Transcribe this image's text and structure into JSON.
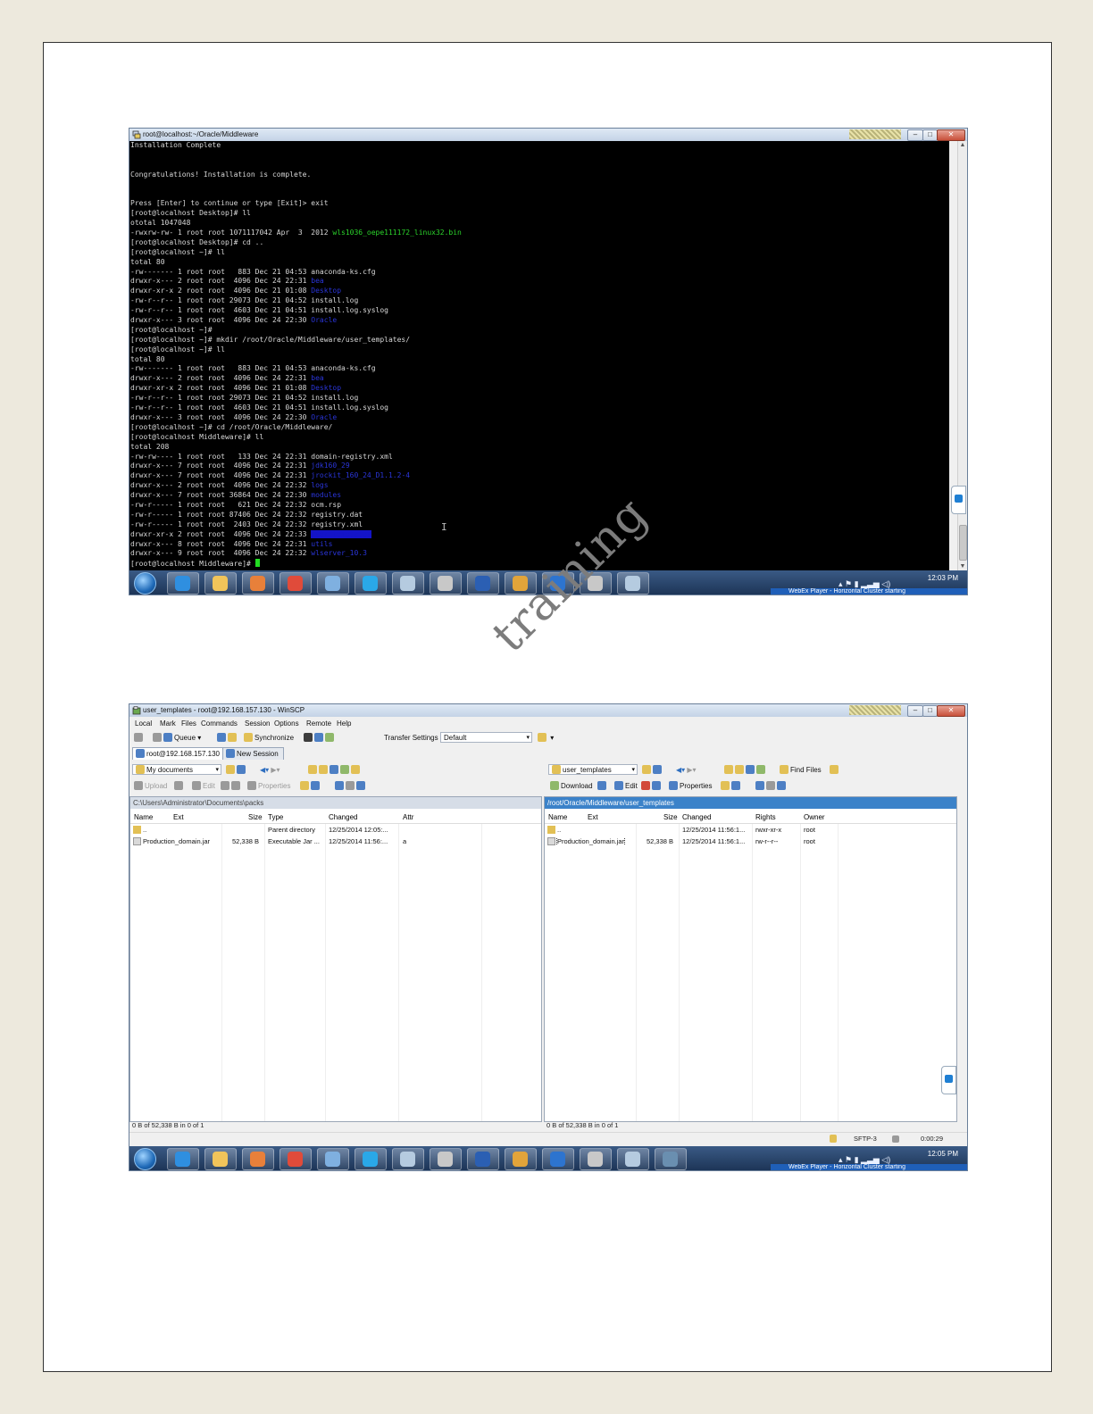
{
  "terminal_window": {
    "title": "root@localhost:~/Oracle/Middleware",
    "lines": [
      [
        {
          "t": "Installation Complete"
        }
      ],
      [
        {
          "t": ""
        }
      ],
      [
        {
          "t": ""
        }
      ],
      [
        {
          "t": "Congratulations! Installation is complete."
        }
      ],
      [
        {
          "t": ""
        }
      ],
      [
        {
          "t": ""
        }
      ],
      [
        {
          "t": "Press [Enter] to continue or type [Exit]> exit"
        }
      ],
      [
        {
          "t": "[root@localhost Desktop]# ll"
        }
      ],
      [
        {
          "t": "ototal 1047048"
        }
      ],
      [
        {
          "t": "-rwxrw-rw- 1 root root 1071117042 Apr  3  2012 "
        },
        {
          "t": "wls1036_oepe111172_linux32.bin",
          "c": "green"
        }
      ],
      [
        {
          "t": "[root@localhost Desktop]# cd .."
        }
      ],
      [
        {
          "t": "[root@localhost ~]# ll"
        }
      ],
      [
        {
          "t": "total 80"
        }
      ],
      [
        {
          "t": "-rw------- 1 root root   883 Dec 21 04:53 anaconda-ks.cfg"
        }
      ],
      [
        {
          "t": "drwxr-x--- 2 root root  4096 Dec 24 22:31 "
        },
        {
          "t": "bea",
          "c": "blue"
        }
      ],
      [
        {
          "t": "drwxr-xr-x 2 root root  4096 Dec 21 01:08 "
        },
        {
          "t": "Desktop",
          "c": "blue"
        }
      ],
      [
        {
          "t": "-rw-r--r-- 1 root root 29073 Dec 21 04:52 install.log"
        }
      ],
      [
        {
          "t": "-rw-r--r-- 1 root root  4603 Dec 21 04:51 install.log.syslog"
        }
      ],
      [
        {
          "t": "drwxr-x--- 3 root root  4096 Dec 24 22:30 "
        },
        {
          "t": "Oracle",
          "c": "blue"
        }
      ],
      [
        {
          "t": "[root@localhost ~]#"
        }
      ],
      [
        {
          "t": "[root@localhost ~]# mkdir /root/Oracle/Middleware/user_templates/"
        }
      ],
      [
        {
          "t": "[root@localhost ~]# ll"
        }
      ],
      [
        {
          "t": "total 80"
        }
      ],
      [
        {
          "t": "-rw------- 1 root root   883 Dec 21 04:53 anaconda-ks.cfg"
        }
      ],
      [
        {
          "t": "drwxr-x--- 2 root root  4096 Dec 24 22:31 "
        },
        {
          "t": "bea",
          "c": "blue"
        }
      ],
      [
        {
          "t": "drwxr-xr-x 2 root root  4096 Dec 21 01:08 "
        },
        {
          "t": "Desktop",
          "c": "blue"
        }
      ],
      [
        {
          "t": "-rw-r--r-- 1 root root 29073 Dec 21 04:52 install.log"
        }
      ],
      [
        {
          "t": "-rw-r--r-- 1 root root  4603 Dec 21 04:51 install.log.syslog"
        }
      ],
      [
        {
          "t": "drwxr-x--- 3 root root  4096 Dec 24 22:30 "
        },
        {
          "t": "Oracle",
          "c": "blue"
        }
      ],
      [
        {
          "t": "[root@localhost ~]# cd /root/Oracle/Middleware/"
        }
      ],
      [
        {
          "t": "[root@localhost Middleware]# ll"
        }
      ],
      [
        {
          "t": "total 208"
        }
      ],
      [
        {
          "t": "-rw-rw---- 1 root root   133 Dec 24 22:31 domain-registry.xml"
        }
      ],
      [
        {
          "t": "drwxr-x--- 7 root root  4096 Dec 24 22:31 "
        },
        {
          "t": "jdk160_29",
          "c": "blue"
        }
      ],
      [
        {
          "t": "drwxr-x--- 7 root root  4096 Dec 24 22:31 "
        },
        {
          "t": "jrockit_160_24_D1.1.2-4",
          "c": "blue"
        }
      ],
      [
        {
          "t": "drwxr-x--- 2 root root  4096 Dec 24 22:32 "
        },
        {
          "t": "logs",
          "c": "blue"
        }
      ],
      [
        {
          "t": "drwxr-x--- 7 root root 36864 Dec 24 22:30 "
        },
        {
          "t": "modules",
          "c": "blue"
        }
      ],
      [
        {
          "t": "-rw-r----- 1 root root   621 Dec 24 22:32 ocm.rsp"
        }
      ],
      [
        {
          "t": "-rw-r----- 1 root root 87406 Dec 24 22:32 registry.dat"
        }
      ],
      [
        {
          "t": "-rw-r----- 1 root root  2403 Dec 24 22:32 registry.xml"
        }
      ],
      [
        {
          "t": "drwxr-xr-x 2 root root  4096 Dec 24 22:33 "
        },
        {
          "t": "user_templates",
          "c": "sel"
        }
      ],
      [
        {
          "t": "drwxr-x--- 8 root root  4096 Dec 24 22:31 "
        },
        {
          "t": "utils",
          "c": "blue"
        }
      ],
      [
        {
          "t": "drwxr-x--- 9 root root  4096 Dec 24 22:32 "
        },
        {
          "t": "wlserver_10.3",
          "c": "blue"
        }
      ],
      [
        {
          "t": "[root@localhost Middleware]# "
        },
        {
          "t": "",
          "c": "cursor"
        }
      ]
    ]
  },
  "taskbar_top": {
    "clock": "12:03 PM",
    "notification": "WebEx Player - Horizontal Cluster starting"
  },
  "taskbar_bottom": {
    "clock": "12:05 PM",
    "notification": "WebEx Player - Horizontal Cluster starting"
  },
  "taskbar_icon_names": [
    "internet-explorer-icon",
    "file-explorer-icon",
    "media-player-icon",
    "chrome-icon",
    "remote-desktop-icon",
    "skype-icon",
    "notepad-icon",
    "putty-icon",
    "word-icon",
    "vmware-icon",
    "teamviewer-icon",
    "putty-icon",
    "notepad-icon",
    "winscp-icon"
  ],
  "watermark": "training",
  "winscp": {
    "title": "user_templates - root@192.168.157.130 - WinSCP",
    "menu": [
      "Local",
      "Mark",
      "Files",
      "Commands",
      "Session",
      "Options",
      "Remote",
      "Help"
    ],
    "toolbar": {
      "queue": "Queue",
      "synchronize": "Synchronize",
      "transfer_settings_label": "Transfer Settings",
      "transfer_settings_value": "Default"
    },
    "tabs": {
      "active": "root@192.168.157.130",
      "new": "New Session"
    },
    "left": {
      "location": "My documents",
      "actions": {
        "upload": "Upload",
        "edit": "Edit",
        "properties": "Properties"
      },
      "path": "C:\\Users\\Administrator\\Documents\\packs",
      "columns": [
        "Name",
        "Ext",
        "Size",
        "Type",
        "Changed",
        "Attr"
      ],
      "rows": [
        {
          "name": "..",
          "size": "",
          "type": "Parent directory",
          "changed": "12/25/2014  12:05:...",
          "attr": ""
        },
        {
          "name": "Production_domain.jar",
          "size": "52,338 B",
          "type": "Executable Jar ...",
          "changed": "12/25/2014  11:56:...",
          "attr": "a"
        }
      ],
      "status": "0 B of 52,338 B in 0 of 1"
    },
    "right": {
      "location": "user_templates",
      "actions": {
        "download": "Download",
        "edit": "Edit",
        "properties": "Properties",
        "find": "Find Files"
      },
      "path": "/root/Oracle/Middleware/user_templates",
      "columns": [
        "Name",
        "Ext",
        "Size",
        "Changed",
        "Rights",
        "Owner"
      ],
      "rows": [
        {
          "name": "..",
          "size": "",
          "changed": "12/25/2014  11:56:1...",
          "rights": "rwxr-xr-x",
          "owner": "root"
        },
        {
          "name": "Production_domain.jar",
          "size": "52,338 B",
          "changed": "12/25/2014  11:56:1...",
          "rights": "rw-r--r--",
          "owner": "root"
        }
      ],
      "status": "0 B of 52,338 B in 0 of 1"
    },
    "statusbar": {
      "protocol": "SFTP-3",
      "elapsed": "0:00:29"
    }
  }
}
